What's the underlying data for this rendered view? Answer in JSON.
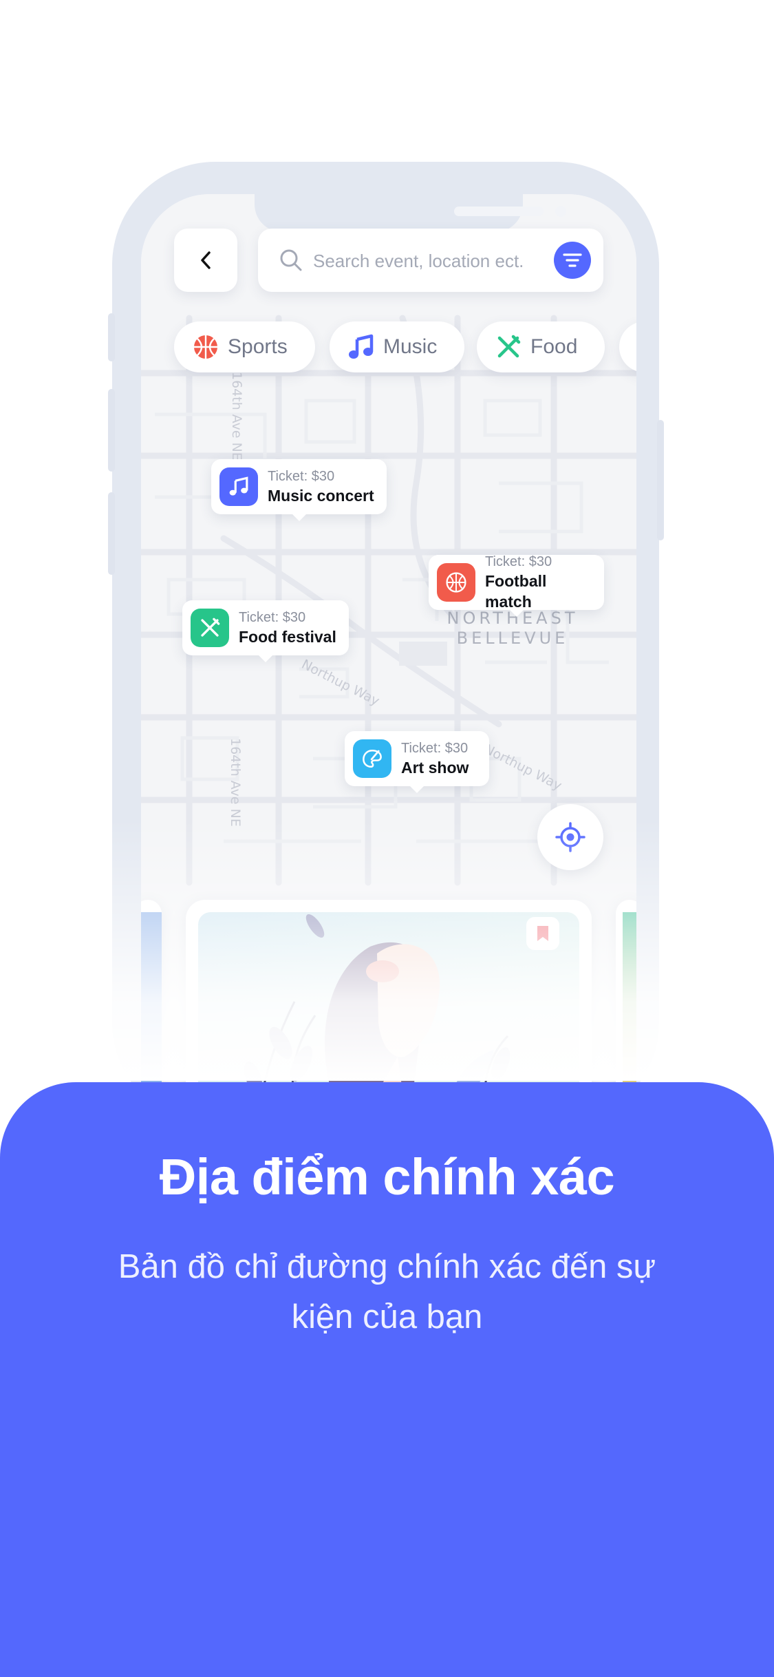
{
  "search": {
    "placeholder": "Search event, location ect."
  },
  "chips": [
    {
      "label": "Sports",
      "icon": "basketball-icon",
      "color": "#f15b4b"
    },
    {
      "label": "Music",
      "icon": "music-note-icon",
      "color": "#5468ff"
    },
    {
      "label": "Food",
      "icon": "fork-knife-icon",
      "color": "#27c58a"
    }
  ],
  "map": {
    "streets": [
      "164th Ave NE",
      "164th Ave NE",
      "Northup Way",
      "Northup Way"
    ],
    "area_label": [
      "NORTHEAST",
      "BELLEVUE"
    ]
  },
  "pins": [
    {
      "price": "Ticket: $30",
      "title": "Music concert",
      "icon": "music-note-icon",
      "color": "#5468ff"
    },
    {
      "price": "Ticket: $30",
      "title": "Football match",
      "icon": "basketball-icon",
      "color": "#f15b4b"
    },
    {
      "price": "Ticket: $30",
      "title": "Food festival",
      "icon": "fork-knife-icon",
      "color": "#27c58a"
    },
    {
      "price": "Ticket: $30",
      "title": "Art show",
      "icon": "palette-icon",
      "color": "#31b6f2"
    }
  ],
  "headline": "Địa điểm chính xác",
  "subtitle": "Bản đồ chỉ đường chính xác đến sự kiện của bạn",
  "colors": {
    "accent": "#5468fd",
    "background": "#ffffff"
  }
}
